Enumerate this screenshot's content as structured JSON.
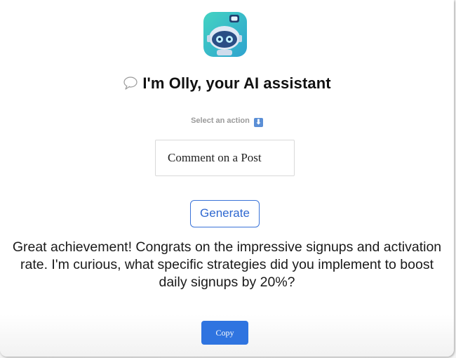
{
  "header": {
    "title": "I'm Olly, your AI assistant",
    "logo_icon": "robot-logo-icon",
    "title_icon": "speech-bubble-icon"
  },
  "action": {
    "label": "Select an action",
    "label_icon": "down-arrow-icon",
    "selected": "Comment on a Post"
  },
  "buttons": {
    "generate_label": "Generate",
    "copy_label": "Copy"
  },
  "result": {
    "text": "Great achievement! Congrats on the impressive signups and activation rate. I'm curious, what specific strategies did you implement to boost daily signups by 20%?"
  },
  "colors": {
    "accent": "#2f74e0",
    "logo_teal": "#3ec9c0"
  }
}
